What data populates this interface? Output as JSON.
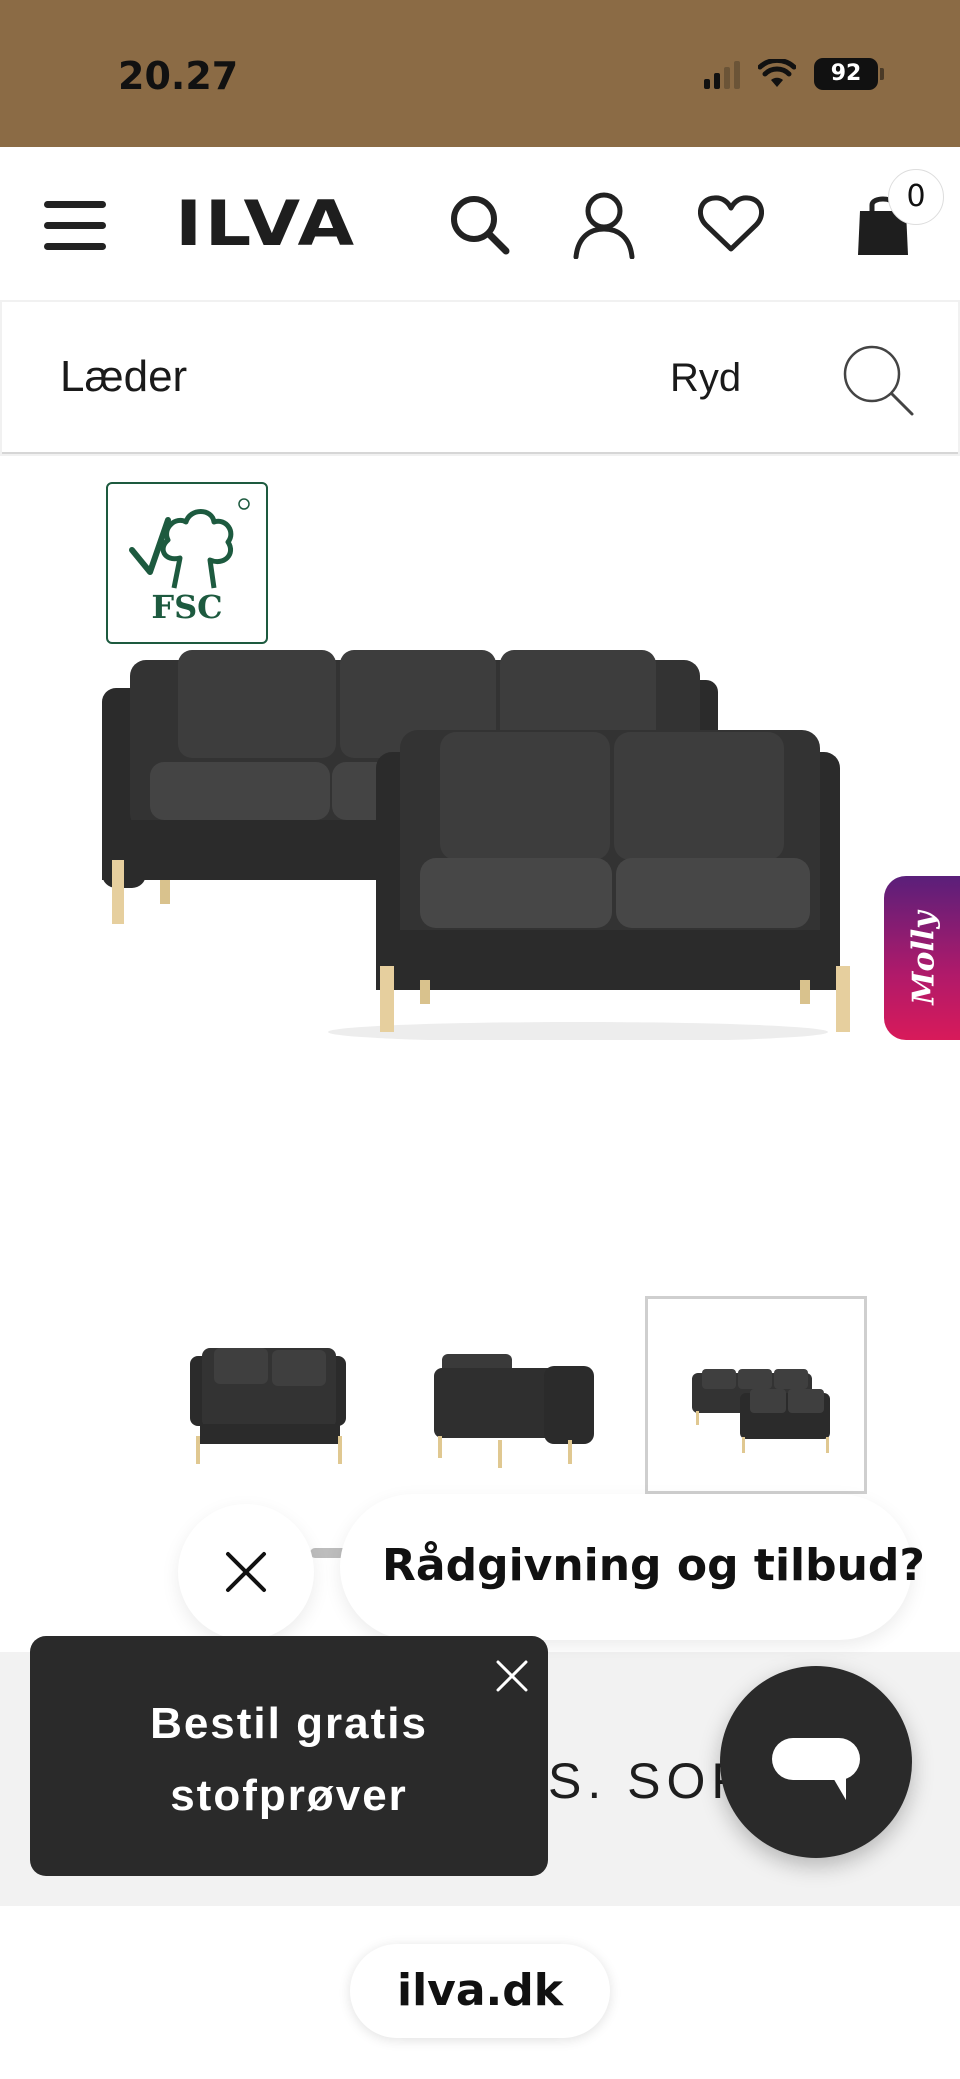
{
  "status_bar": {
    "time": "20.27",
    "battery": "92"
  },
  "header": {
    "logo": "ILVA",
    "cart_count": "0",
    "icons": [
      "menu-icon",
      "search-icon",
      "account-icon",
      "heart-icon",
      "cart-icon"
    ]
  },
  "filter": {
    "query": "Læder",
    "clear_label": "Ryd"
  },
  "product": {
    "certification": "FSC",
    "name_partial": "S. SOFA",
    "thumbnail_count": 3,
    "active_thumbnail": 3
  },
  "molly": {
    "label": "Molly"
  },
  "chat": {
    "prompt": "Rådgivning og tilbud?"
  },
  "toast": {
    "text": "Bestil gratis\nstofprøver"
  },
  "browser": {
    "url": "ilva.dk"
  },
  "colors": {
    "status_bar_bg": "#8b6b45",
    "fsc_green": "#1d5a3f",
    "dark_panel": "#2a2a2a"
  }
}
